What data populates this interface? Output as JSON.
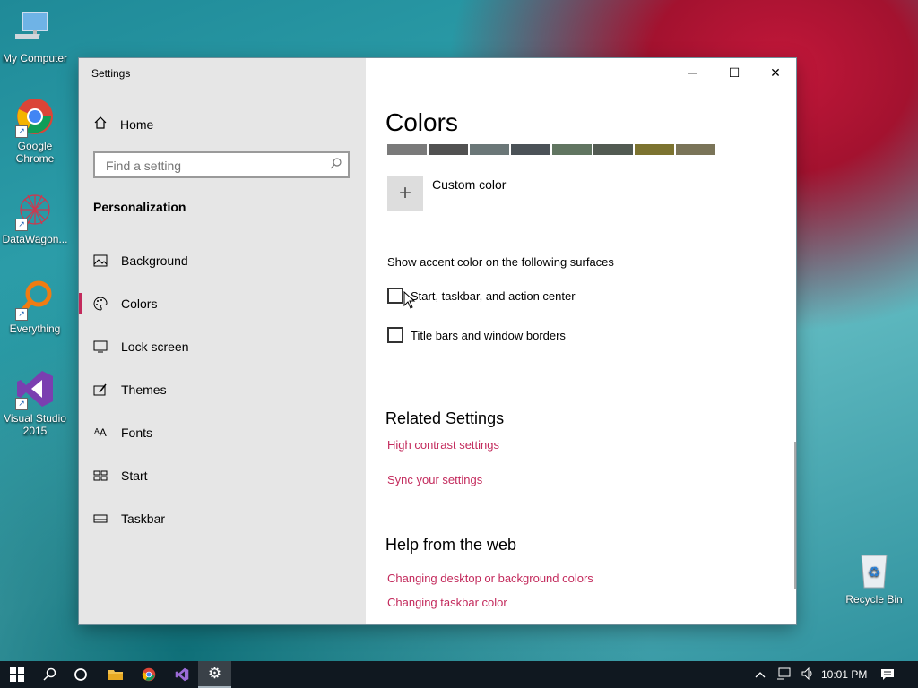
{
  "desktop": {
    "icons": [
      {
        "label": "My Computer"
      },
      {
        "label": "Google Chrome"
      },
      {
        "label": "DataWagon..."
      },
      {
        "label": "Everything"
      },
      {
        "label": "Visual Studio 2015"
      },
      {
        "label": "Recycle Bin"
      }
    ]
  },
  "window": {
    "title": "Settings",
    "controls": {
      "minimize": "─",
      "maximize": "☐",
      "close": "✕"
    }
  },
  "sidebar": {
    "home_label": "Home",
    "search_placeholder": "Find a setting",
    "section": "Personalization",
    "items": [
      {
        "label": "Background",
        "icon": "picture-icon"
      },
      {
        "label": "Colors",
        "icon": "palette-icon",
        "active": true
      },
      {
        "label": "Lock screen",
        "icon": "monitor-icon"
      },
      {
        "label": "Themes",
        "icon": "brush-icon"
      },
      {
        "label": "Fonts",
        "icon": "fonts-icon"
      },
      {
        "label": "Start",
        "icon": "start-grid-icon"
      },
      {
        "label": "Taskbar",
        "icon": "taskbar-icon"
      }
    ]
  },
  "main": {
    "title": "Colors",
    "swatches": [
      "#7a7a7a",
      "#515151",
      "#6b7778",
      "#4b5257",
      "#617561",
      "#525a52",
      "#7c7330",
      "#7a7458"
    ],
    "custom_color": "Custom color",
    "accent_desc": "Show accent color on the following surfaces",
    "checkboxes": [
      {
        "label": "Start, taskbar, and action center",
        "checked": false
      },
      {
        "label": "Title bars and window borders",
        "checked": false
      }
    ],
    "related_title": "Related Settings",
    "related_links": [
      "High contrast settings",
      "Sync your settings"
    ],
    "help_title": "Help from the web",
    "help_links": [
      "Changing desktop or background colors",
      "Changing taskbar color"
    ]
  },
  "taskbar": {
    "time": "10:01 PM"
  },
  "colors": {
    "accent": "#c32a5c",
    "sidebar": "#e6e6e6",
    "taskbar": "#101820"
  }
}
